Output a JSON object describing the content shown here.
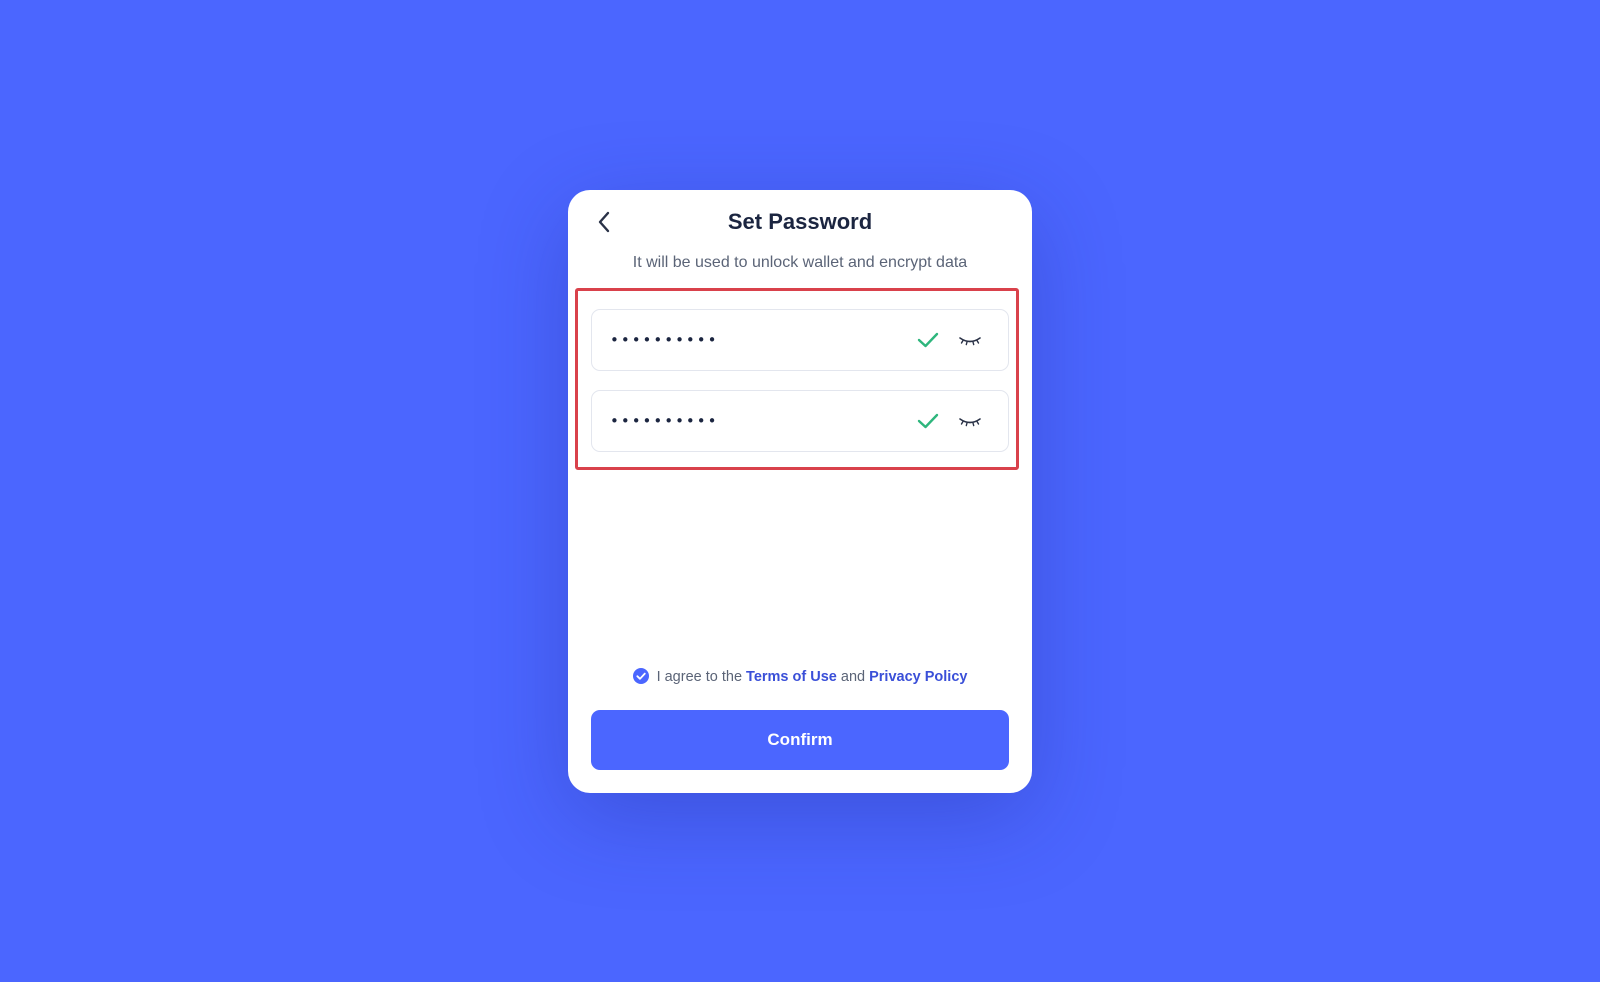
{
  "header": {
    "title": "Set Password",
    "subtitle": "It will be used to unlock wallet and encrypt data"
  },
  "fields": [
    {
      "value": "••••••••••",
      "valid": true,
      "check_icon": "check-icon",
      "toggle_icon": "eye-closed-icon"
    },
    {
      "value": "••••••••••",
      "valid": true,
      "check_icon": "check-icon",
      "toggle_icon": "eye-closed-icon"
    }
  ],
  "agreement": {
    "checked": true,
    "prefix": "I agree to the",
    "terms_label": "Terms of Use",
    "conjunction": "and",
    "privacy_label": "Privacy Policy"
  },
  "actions": {
    "confirm_label": "Confirm"
  },
  "colors": {
    "background": "#4b66ff",
    "accent": "#4b66ff",
    "link": "#3a4fd8",
    "valid_check": "#2eb67d",
    "highlight_border": "#d9414b"
  }
}
